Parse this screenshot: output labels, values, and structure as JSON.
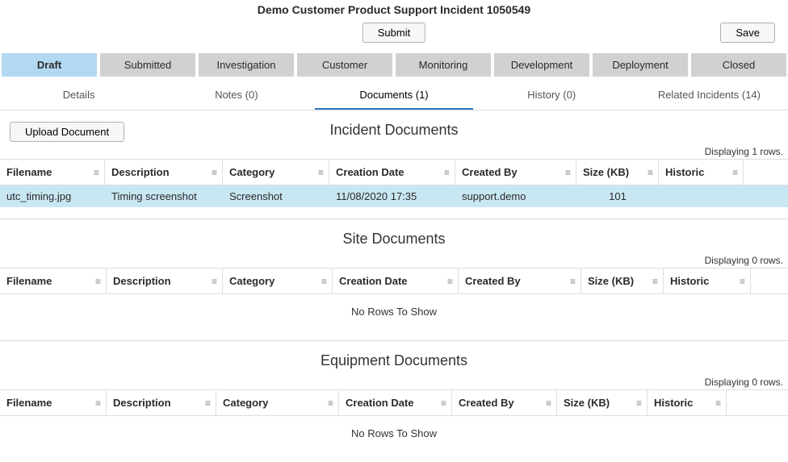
{
  "header": {
    "title": "Demo Customer Product Support Incident 1050549",
    "submit": "Submit",
    "save": "Save"
  },
  "status_tabs": [
    "Draft",
    "Submitted",
    "Investigation",
    "Customer",
    "Monitoring",
    "Development",
    "Deployment",
    "Closed"
  ],
  "status_active": 0,
  "section_tabs": [
    "Details",
    "Notes (0)",
    "Documents (1)",
    "History (0)",
    "Related Incidents (14)"
  ],
  "section_active": 2,
  "upload_label": "Upload Document",
  "no_rows": "No Rows To Show",
  "columns": {
    "filename": "Filename",
    "description": "Description",
    "category": "Category",
    "creation": "Creation Date",
    "createdby": "Created By",
    "size": "Size (KB)",
    "historic": "Historic"
  },
  "sections": {
    "incident": {
      "title": "Incident Documents",
      "rowcount": "Displaying 1 rows.",
      "rows": [
        {
          "filename": "utc_timing.jpg",
          "description": "Timing screenshot",
          "category": "Screenshot",
          "creation": "11/08/2020 17:35",
          "createdby": "support.demo",
          "size": "101",
          "historic": ""
        }
      ]
    },
    "site": {
      "title": "Site Documents",
      "rowcount": "Displaying 0 rows."
    },
    "equipment": {
      "title": "Equipment Documents",
      "rowcount": "Displaying 0 rows."
    }
  }
}
